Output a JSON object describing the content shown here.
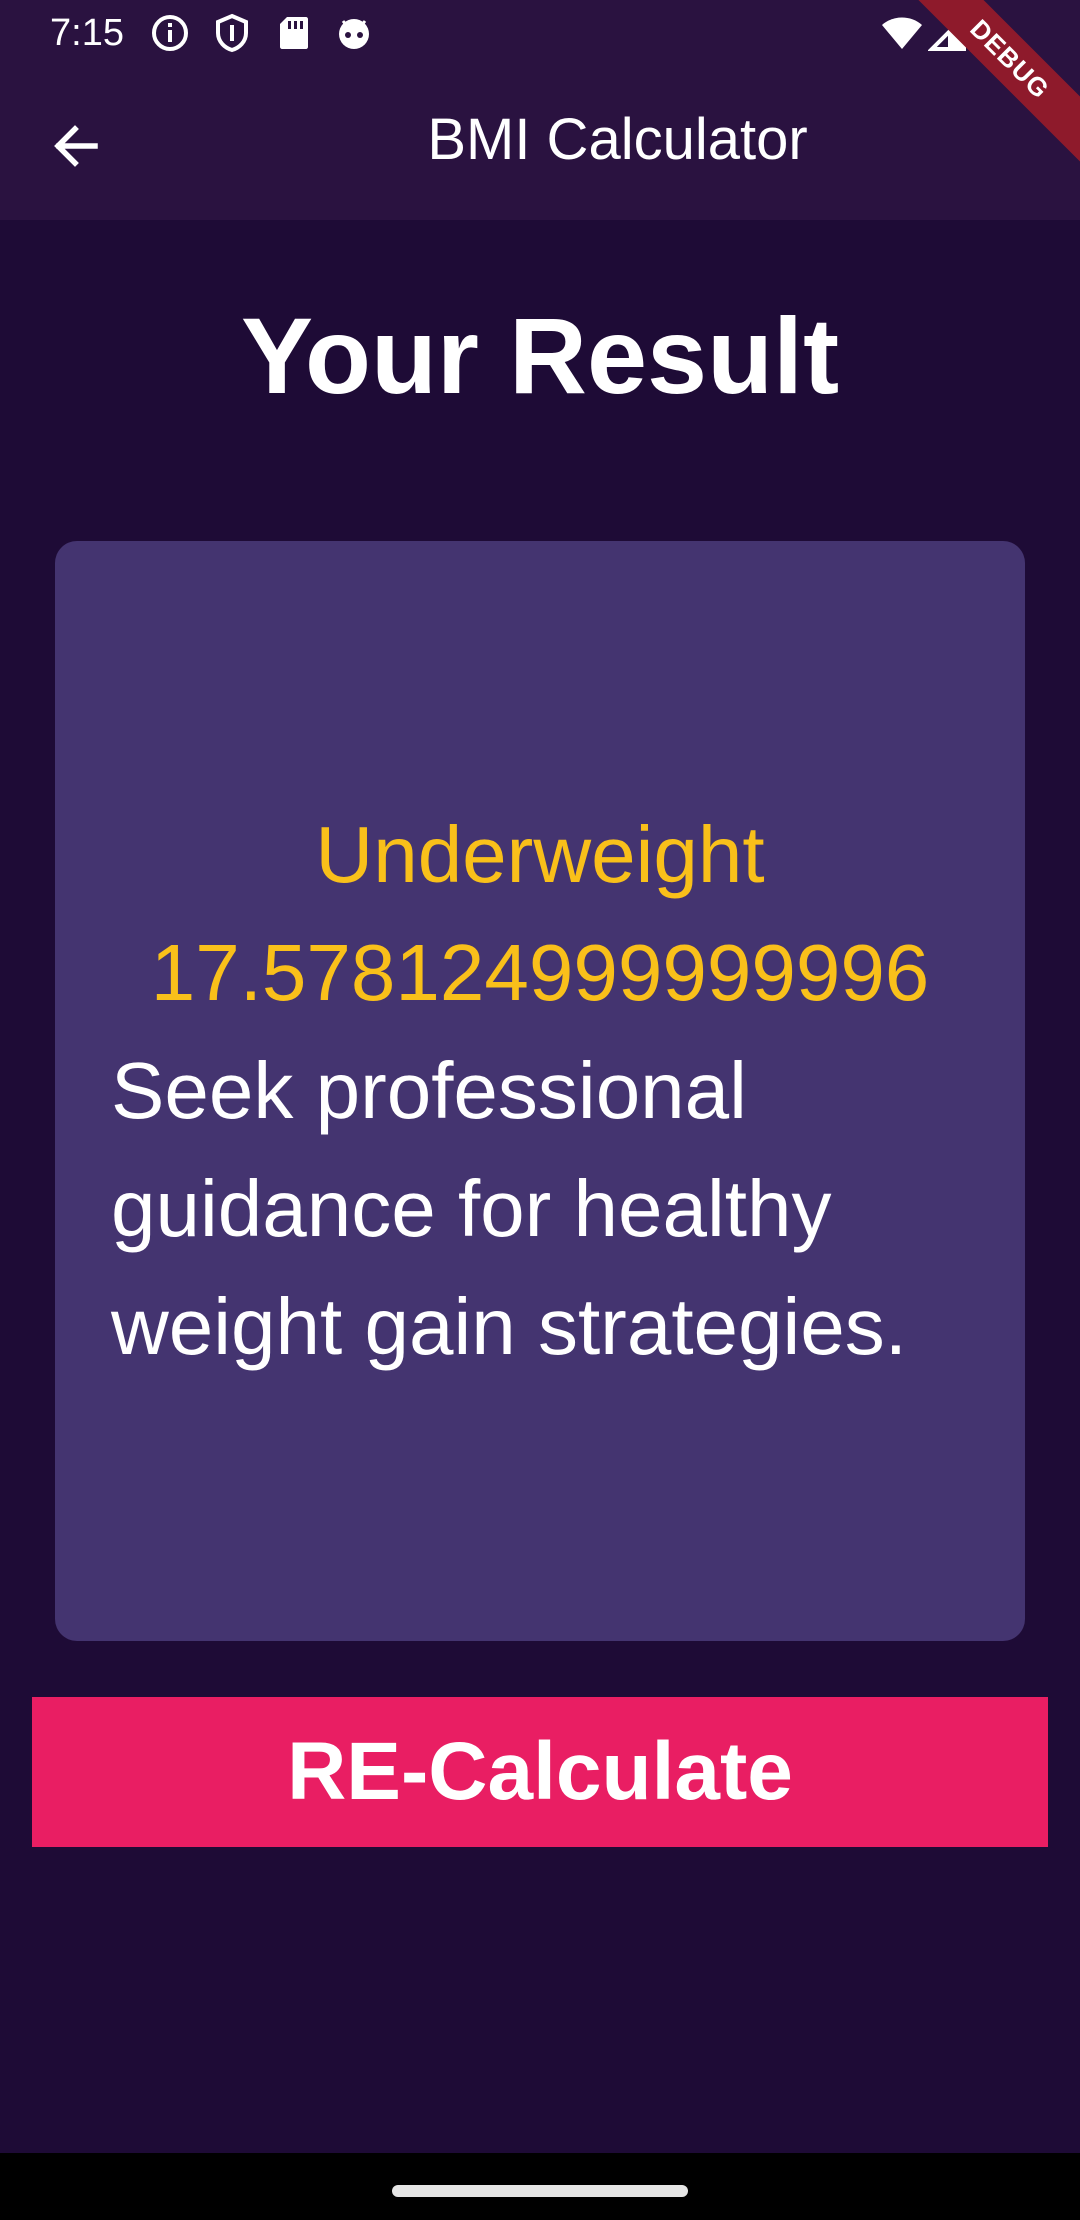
{
  "status_bar": {
    "time": "7:15",
    "icons": [
      "info-icon",
      "shield-icon",
      "sd-card-icon",
      "android-icon"
    ],
    "right_icons": [
      "wifi-icon",
      "signal-icon"
    ]
  },
  "debug_banner": {
    "label": "DEBUG"
  },
  "app_bar": {
    "title": "BMI Calculator",
    "back_icon": "arrow-back-icon"
  },
  "page": {
    "heading": "Your Result"
  },
  "result": {
    "category": "Underweight",
    "bmi_value": "17.578124999999996",
    "advice": "Seek professional guidance for healthy weight gain strategies."
  },
  "actions": {
    "recalculate_label": "RE-Calculate"
  },
  "colors": {
    "background": "#1e0b36",
    "app_bar": "#2a1240",
    "card": "#443470",
    "highlight": "#f9c01a",
    "button": "#e91e63",
    "debug_banner": "#8e1a2b"
  }
}
